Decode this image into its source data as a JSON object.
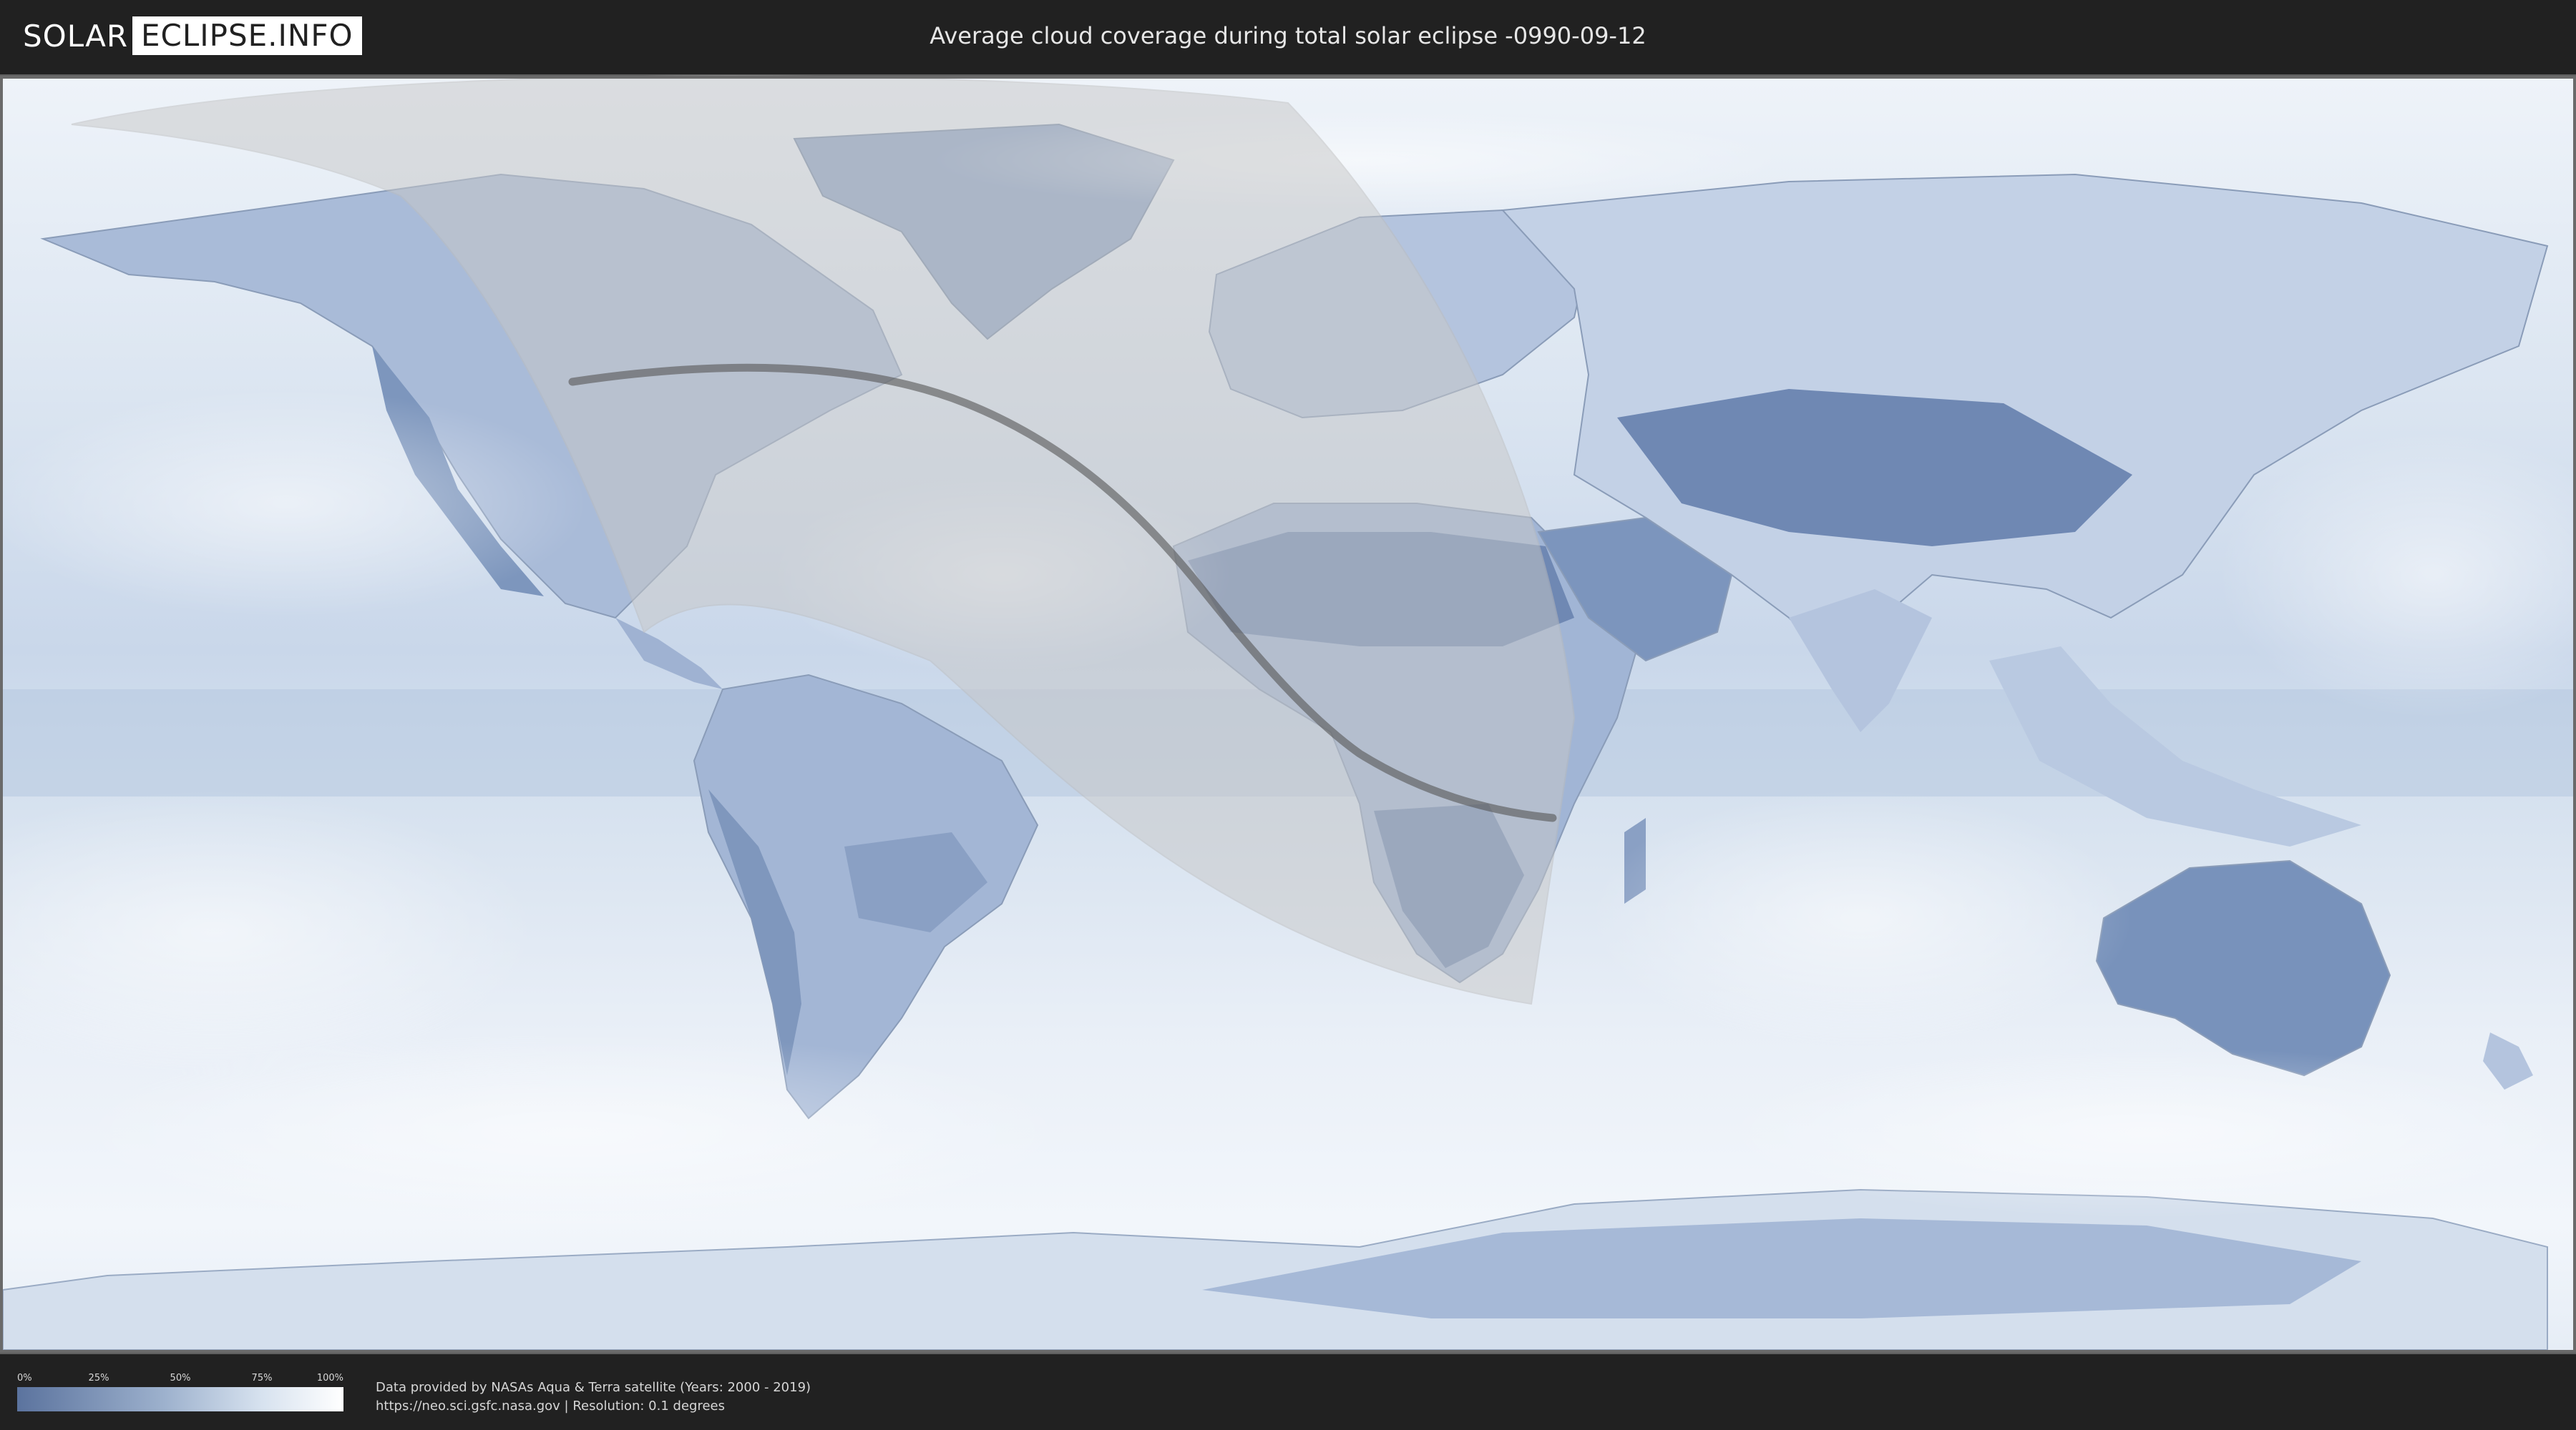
{
  "header": {
    "logo_left": "SOLAR",
    "logo_right": "ECLIPSE.INFO",
    "title": "Average cloud coverage during total solar eclipse -0990-09-12"
  },
  "legend": {
    "ticks": [
      "0%",
      "25%",
      "50%",
      "75%",
      "100%"
    ],
    "low_color": "#5b739e",
    "high_color": "#ffffff"
  },
  "footer": {
    "credit_line1": "Data provided by NASAs Aqua & Terra satellite (Years: 2000 - 2019)",
    "credit_line2": "https://neo.sci.gsfc.nasa.gov | Resolution: 0.1 degrees"
  },
  "map": {
    "ocean_color": "#e4ecf5",
    "land_color": "#7f97bd",
    "penumbra_color": "#c8c8c8",
    "path_color": "#555555"
  }
}
